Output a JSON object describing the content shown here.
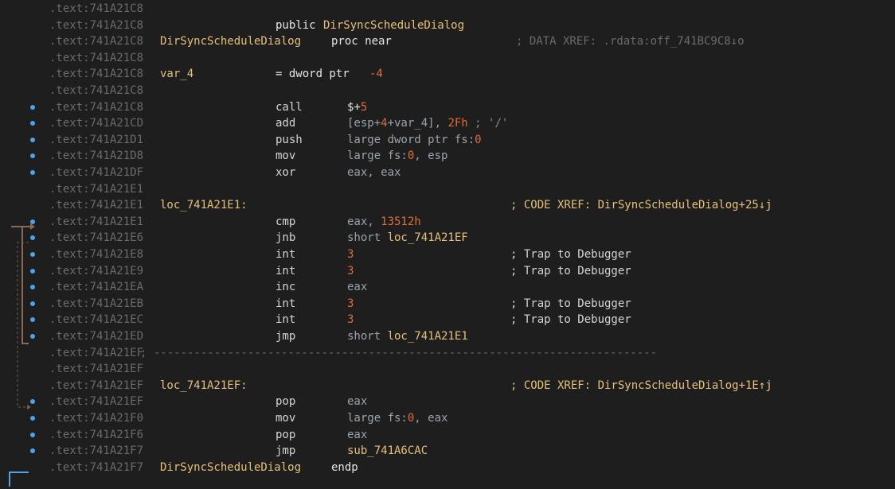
{
  "lines": [
    {
      "addr": ".text:741A21C8"
    },
    {
      "addr": ".text:741A21C8",
      "kw": "public",
      "name": "DirSyncScheduleDialog"
    },
    {
      "addr": ".text:741A21C8",
      "label": "DirSyncScheduleDialog",
      "proc": "proc near",
      "comment": "; DATA XREF: .rdata:off_741BC9C8↓o"
    },
    {
      "addr": ".text:741A21C8"
    },
    {
      "addr": ".text:741A21C8",
      "label": "var_4",
      "eq": "= dword ptr",
      "num": "-4"
    },
    {
      "addr": ".text:741A21C8"
    },
    {
      "addr": ".text:741A21C8",
      "mnem": "call",
      "op1": "$+",
      "op1n": "5"
    },
    {
      "addr": ".text:741A21CD",
      "mnem": "add",
      "op_a": "[esp+",
      "op_b": "4",
      "op_c": "+var_4], ",
      "op_d": "2Fh",
      "op_e": " ; '/'"
    },
    {
      "addr": ".text:741A21D1",
      "mnem": "push",
      "op_a": "large dword ptr fs:",
      "op_b": "0"
    },
    {
      "addr": ".text:741A21D8",
      "mnem": "mov",
      "op_a": "large fs:",
      "op_b": "0",
      "op_c": ", esp"
    },
    {
      "addr": ".text:741A21DF",
      "mnem": "xor",
      "op_a": "eax, eax"
    },
    {
      "addr": ".text:741A21E1"
    },
    {
      "addr": ".text:741A21E1",
      "label": "loc_741A21E1:",
      "comment": "; CODE XREF: DirSyncScheduleDialog+25↓j"
    },
    {
      "addr": ".text:741A21E1",
      "mnem": "cmp",
      "op_a": "eax, ",
      "op_b": "13512h"
    },
    {
      "addr": ".text:741A21E6",
      "mnem": "jnb",
      "op_a": "short ",
      "op_y": "loc_741A21EF"
    },
    {
      "addr": ".text:741A21E8",
      "mnem": "int",
      "op_n": "3",
      "comment": "; Trap to Debugger"
    },
    {
      "addr": ".text:741A21E9",
      "mnem": "int",
      "op_n": "3",
      "comment": "; Trap to Debugger"
    },
    {
      "addr": ".text:741A21EA",
      "mnem": "inc",
      "op_a": "eax"
    },
    {
      "addr": ".text:741A21EB",
      "mnem": "int",
      "op_n": "3",
      "comment": "; Trap to Debugger"
    },
    {
      "addr": ".text:741A21EC",
      "mnem": "int",
      "op_n": "3",
      "comment": "; Trap to Debugger"
    },
    {
      "addr": ".text:741A21ED",
      "mnem": "jmp",
      "op_a": "short ",
      "op_y": "loc_741A21E1"
    },
    {
      "addr": ".text:741A21EF",
      "sep": "; ---------------------------------------------------------------------------"
    },
    {
      "addr": ".text:741A21EF"
    },
    {
      "addr": ".text:741A21EF",
      "label": "loc_741A21EF:",
      "comment": "; CODE XREF: DirSyncScheduleDialog+1E↑j"
    },
    {
      "addr": ".text:741A21EF",
      "mnem": "pop",
      "op_a": "eax"
    },
    {
      "addr": ".text:741A21F0",
      "mnem": "mov",
      "op_a": "large fs:",
      "op_b": "0",
      "op_c": ", eax"
    },
    {
      "addr": ".text:741A21F6",
      "mnem": "pop",
      "op_a": "eax"
    },
    {
      "addr": ".text:741A21F7",
      "mnem": "jmp",
      "op_y": "sub_741A6CAC"
    },
    {
      "addr": ".text:741A21F7",
      "label": "DirSyncScheduleDialog",
      "endp": "endp"
    }
  ],
  "colors": {
    "background": "#1e1e1e",
    "address": "#6b6b6b",
    "label": "#e5c07b",
    "number": "#e06c3c",
    "register": "#9aa3ad",
    "breakpoint_dot": "#4fa3e8",
    "arrow": "#8a6a55"
  }
}
